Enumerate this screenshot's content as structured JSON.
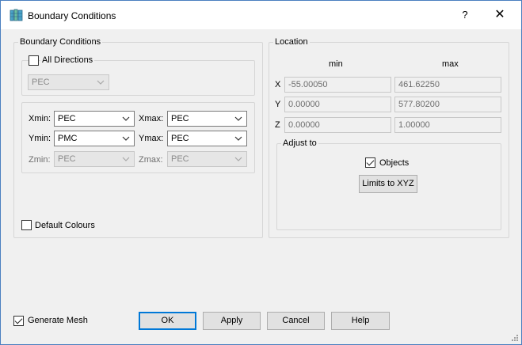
{
  "window": {
    "title": "Boundary Conditions",
    "help_label": "?",
    "close_label": "✕"
  },
  "boundary": {
    "group_title": "Boundary Conditions",
    "all_directions": {
      "label": "All Directions",
      "checked": false
    },
    "all_value": "PEC",
    "rows": [
      {
        "min_label": "Xmin:",
        "min_value": "PEC",
        "max_label": "Xmax:",
        "max_value": "PEC"
      },
      {
        "min_label": "Ymin:",
        "min_value": "PMC",
        "max_label": "Ymax:",
        "max_value": "PEC"
      },
      {
        "min_label": "Zmin:",
        "min_value": "PEC",
        "max_label": "Zmax:",
        "max_value": "PEC"
      }
    ],
    "default_colours": {
      "label": "Default Colours",
      "checked": false
    }
  },
  "location": {
    "group_title": "Location",
    "min_header": "min",
    "max_header": "max",
    "rows": [
      {
        "axis": "X",
        "min": "-55.00050",
        "max": "461.62250"
      },
      {
        "axis": "Y",
        "min": "0.00000",
        "max": "577.80200"
      },
      {
        "axis": "Z",
        "min": "0.00000",
        "max": "1.00000"
      }
    ],
    "adjust": {
      "group_title": "Adjust to",
      "objects": {
        "label": "Objects",
        "checked": true
      },
      "limits_button": "Limits to XYZ"
    }
  },
  "footer": {
    "generate_mesh": {
      "label": "Generate Mesh",
      "checked": true
    },
    "ok": "OK",
    "apply": "Apply",
    "cancel": "Cancel",
    "help": "Help"
  },
  "colors": {
    "accent": "#0078d7",
    "border": "#4a7fc0"
  }
}
